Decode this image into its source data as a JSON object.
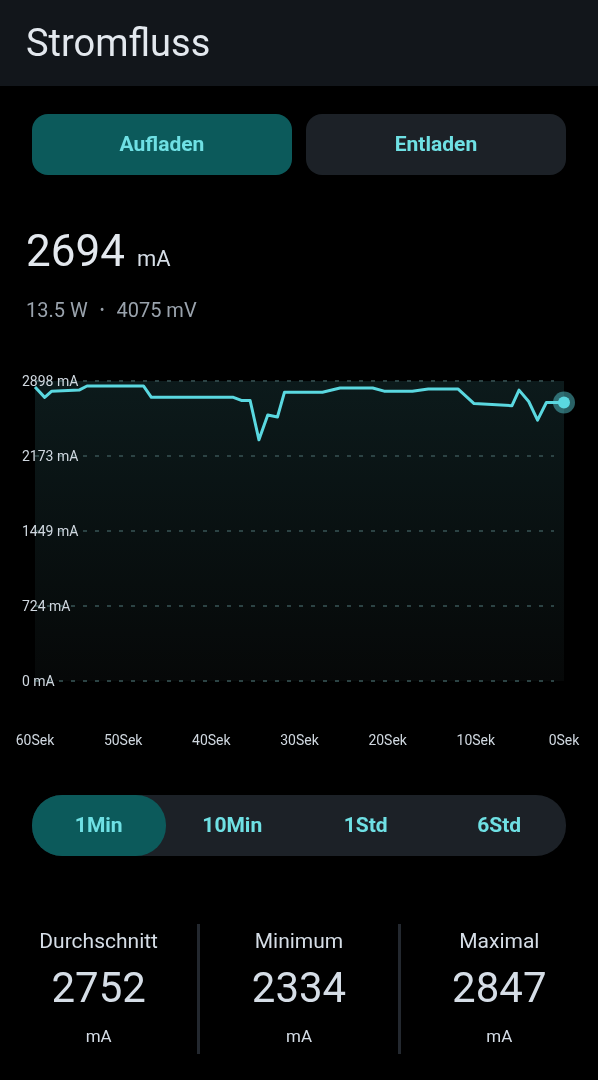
{
  "header": {
    "title": "Stromfluss"
  },
  "mode_tabs": [
    {
      "label": "Aufladen",
      "selected": true
    },
    {
      "label": "Entladen",
      "selected": false
    }
  ],
  "reading": {
    "value": "2694",
    "unit": "mA",
    "power": "13.5 W",
    "separator": "•",
    "voltage": "4075 mV"
  },
  "chart": {
    "chart_data": {
      "type": "line",
      "x": [
        60,
        58.9,
        58.1,
        55,
        54.1,
        47.7,
        46.8,
        37.5,
        36.6,
        35.6,
        34.6,
        33.6,
        32.5,
        31.7,
        27.4,
        25.4,
        21.7,
        20.4,
        17.2,
        15.4,
        12,
        10.2,
        5.9,
        5.1,
        4,
        3,
        2,
        0
      ],
      "grid": true,
      "series": [
        {
          "color": "#5ad8e0",
          "values": [
            2840,
            2740,
            2800,
            2810,
            2850,
            2850,
            2740,
            2740,
            2710,
            2710,
            2330,
            2570,
            2550,
            2790,
            2790,
            2830,
            2830,
            2800,
            2800,
            2820,
            2820,
            2680,
            2660,
            2810,
            2700,
            2520,
            2690,
            2690
          ]
        }
      ],
      "xlim": [
        60,
        0
      ],
      "ylim": [
        0,
        2898
      ],
      "xticks": [
        {
          "value": 60,
          "label": "60Sek"
        },
        {
          "value": 50,
          "label": "50Sek"
        },
        {
          "value": 40,
          "label": "40Sek"
        },
        {
          "value": 30,
          "label": "30Sek"
        },
        {
          "value": 20,
          "label": "20Sek"
        },
        {
          "value": 10,
          "label": "10Sek"
        },
        {
          "value": 0,
          "label": "0Sek"
        }
      ],
      "yticks": [
        {
          "value": 2898,
          "label": "2898 mA"
        },
        {
          "value": 2173,
          "label": "2173 mA"
        },
        {
          "value": 1449,
          "label": "1449 mA"
        },
        {
          "value": 724,
          "label": "724 mA"
        },
        {
          "value": 0,
          "label": "0 mA"
        }
      ]
    }
  },
  "range_tabs": [
    {
      "label": "1Min",
      "selected": true
    },
    {
      "label": "10Min",
      "selected": false
    },
    {
      "label": "1Std",
      "selected": false
    },
    {
      "label": "6Std",
      "selected": false
    }
  ],
  "stats": [
    {
      "label": "Durchschnitt",
      "value": "2752",
      "unit": "mA"
    },
    {
      "label": "Minimum",
      "value": "2334",
      "unit": "mA"
    },
    {
      "label": "Maximal",
      "value": "2847",
      "unit": "mA"
    }
  ]
}
